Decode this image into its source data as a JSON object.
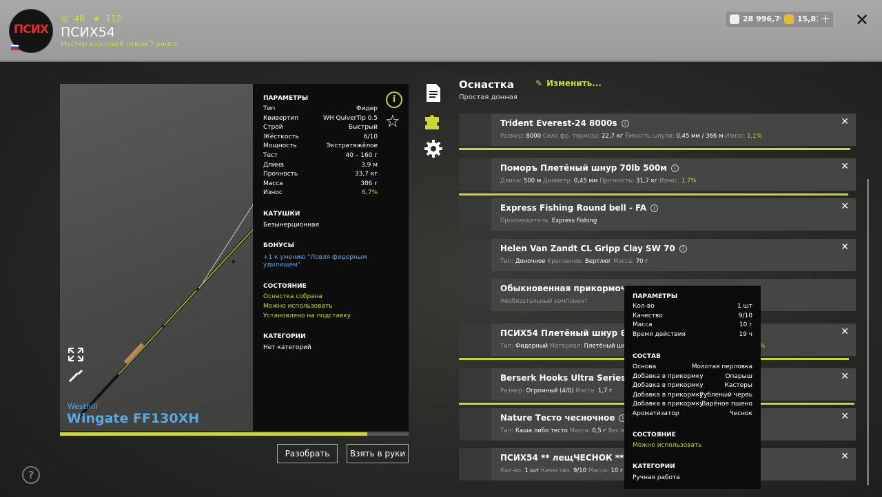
{
  "header": {
    "avatar_text": "ПСИХ",
    "stat_coins": "48",
    "stat_stars": "112",
    "player_name": "ПСИХ54",
    "player_title": "Мастер карповой ловли 7 ранга",
    "silver": "28 996,70",
    "gold": "15,81",
    "plus": "+",
    "close": "✕"
  },
  "rod": {
    "brand": "Westhill",
    "name": "Wingate FF130XH",
    "wear_fraction": 0.933,
    "params_title": "ПАРАМЕТРЫ",
    "params": [
      {
        "label": "Тип",
        "value": "Фидер"
      },
      {
        "label": "Квивертип",
        "value": "WH QuiverTip 0.5"
      },
      {
        "label": "Строй",
        "value": "Быстрый"
      },
      {
        "label": "Жёсткость",
        "value": "6/10"
      },
      {
        "label": "Мощность",
        "value": "Экстратяжёлое"
      },
      {
        "label": "Тест",
        "value": "40 – 160 г"
      },
      {
        "label": "Длина",
        "value": "3,9 м"
      },
      {
        "label": "Прочность",
        "value": "33,7 кг"
      },
      {
        "label": "Масса",
        "value": "386 г"
      },
      {
        "label": "Износ",
        "value": "6,7%"
      }
    ],
    "reels_title": "КАТУШКИ",
    "reels_value": "Безынерционная",
    "bonuses_title": "БОНУСЫ",
    "bonus_line1": "+1 к умению \"Ловля фидерным",
    "bonus_line2": "удилищем\"",
    "state_title": "СОСТОЯНИЕ",
    "state_1": "Оснастка собрана",
    "state_2": "Можно использовать",
    "state_3": "Установлено на подставку",
    "categories_title": "КАТЕГОРИИ",
    "categories_value": "Нет категорий",
    "info": "i",
    "star": "☆"
  },
  "buttons": {
    "disassemble": "Разобрать",
    "take": "Взять в руки",
    "help": "?"
  },
  "tackle": {
    "title": "Оснастка",
    "subtitle": "Простая донная",
    "edit": "Изменить...",
    "items": [
      {
        "name": "Trident Everest-24 8000s",
        "det": [
          [
            "Размер: ",
            "8000"
          ],
          [
            " Сила фр. тормоза: ",
            "22,7 кг"
          ],
          [
            " Ёмкость шпули: ",
            "0,45 мм / 366 м"
          ],
          [
            " Износ: ",
            "1,1%"
          ]
        ],
        "wear_fraction": 0.988
      },
      {
        "name": "Поморъ Плетёный шнур 70lb 500м",
        "det": [
          [
            "Длина: ",
            "500 м"
          ],
          [
            " Диаметр: ",
            "0,45 мм"
          ],
          [
            " Прочность: ",
            "31,7 кг"
          ],
          [
            " Износ: ",
            "1,7%"
          ]
        ],
        "wear_fraction": 0.983
      },
      {
        "name": "Express Fishing Round bell - FA",
        "det": [
          [
            "Производитель: ",
            "Express Fishing"
          ]
        ]
      },
      {
        "name": "Helen Van Zandt CL Gripp Clay SW 70",
        "det": [
          [
            "Тип: ",
            "Доночное"
          ],
          [
            " Крепление: ",
            "Вертлюг"
          ],
          [
            " Масса: ",
            "70 г"
          ]
        ]
      },
      {
        "name": "Обыкновенная прикормочн",
        "det": [
          [
            "Необязательный компонент",
            ""
          ]
        ]
      },
      {
        "name": "ПСИХ54 Плетёный шнур 6,8",
        "det": [
          [
            "Тип: ",
            "Фидерный"
          ],
          [
            " Материал: ",
            "Плетёный шн"
          ]
        ],
        "tail": "%",
        "wear_fraction": 0.985
      },
      {
        "name": "Berserk Hooks Ultra Series S4/",
        "det": [
          [
            "Размер: ",
            "Огромный (4/0)"
          ],
          [
            " Масса: ",
            "1,7 г"
          ]
        ],
        "wear_fraction": 0.998
      },
      {
        "name": "Nature Тесто чесночное",
        "det": [
          [
            "Тип: ",
            "Каша либо тесто"
          ],
          [
            " Масса: ",
            "0,5 г"
          ],
          [
            " Вес в ",
            ""
          ]
        ]
      },
      {
        "name": "ПСИХ54 ** лещЧЕСНОК **",
        "det": [
          [
            "Кол-во: ",
            "1 шт"
          ],
          [
            " Качество: ",
            "9/10"
          ],
          [
            " Масса: ",
            "10 г"
          ]
        ]
      }
    ]
  },
  "tooltip": {
    "params_title": "ПАРАМЕТРЫ",
    "params": [
      {
        "label": "Кол-во",
        "value": "1 шт"
      },
      {
        "label": "Качество",
        "value": "9/10"
      },
      {
        "label": "Масса",
        "value": "10 г"
      },
      {
        "label": "Время действия",
        "value": "19 ч"
      }
    ],
    "comp_title": "СОСТАВ",
    "comp": [
      {
        "label": "Основа",
        "value": "Молотая перловка"
      },
      {
        "label": "Добавка в прикормку",
        "value": "Опарыш"
      },
      {
        "label": "Добавка в прикормку",
        "value": "Кастеры"
      },
      {
        "label": "Добавка в прикормку",
        "value": "Рубленый червь"
      },
      {
        "label": "Добавка в прикормку",
        "value": "Варёное пшено"
      },
      {
        "label": "Ароматизатор",
        "value": "Чеснок"
      }
    ],
    "state_title": "СОСТОЯНИЕ",
    "state_value": "Можно использовать",
    "categories_title": "КАТЕГОРИИ",
    "categories_value": "Ручная работа"
  },
  "colors": {
    "accent": "#c8d63c",
    "link": "#5aa8e6",
    "panel": "#0d0d0d"
  }
}
